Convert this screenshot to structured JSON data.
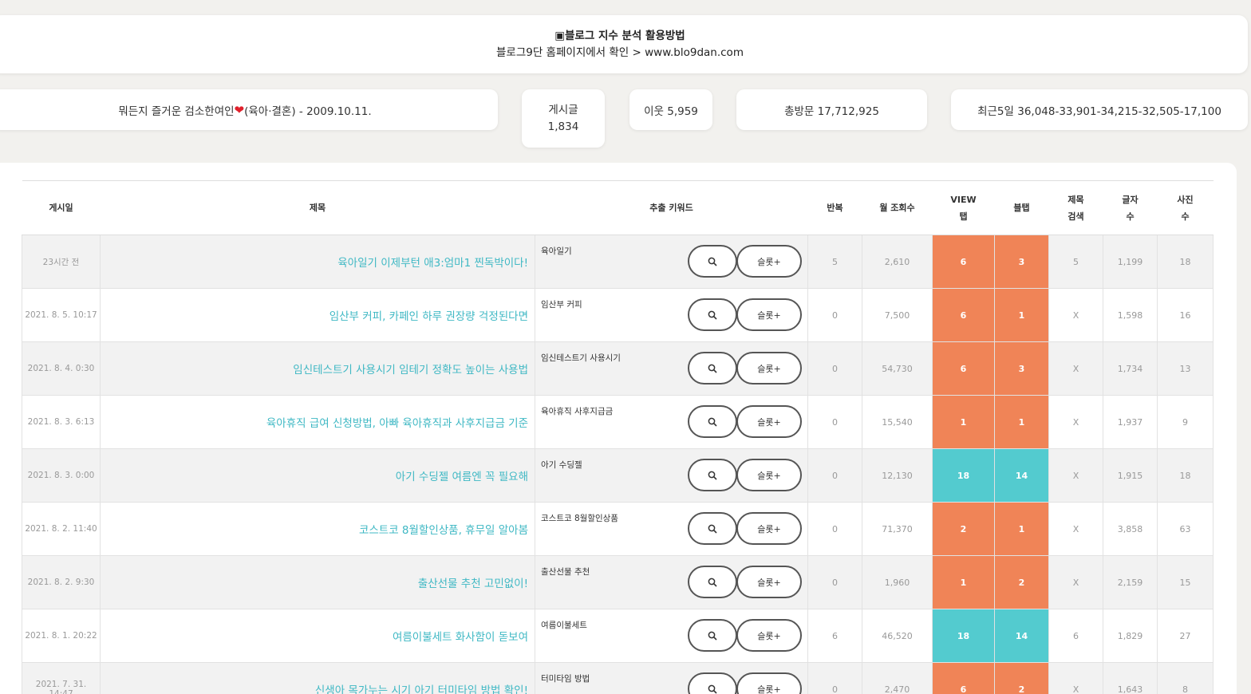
{
  "notice": {
    "line1": "▣블로그 지수 분석 활용방법",
    "line2": "블로그9단 홈페이지에서 확인 > www.blo9dan.com"
  },
  "blog": {
    "name_prefix": "뭐든지 즐거운 검소한여인",
    "heart": "❤",
    "name_suffix": "(육아·결혼) - 2009.10.11.",
    "posts_label": "게시글",
    "posts_value": "1,834",
    "neighbors": "이웃 5,959",
    "total_visits": "총방문 17,712,925",
    "recent5": "최근5일 36,048-33,901-34,215-32,505-17,100"
  },
  "table": {
    "headers": {
      "date": "게시일",
      "title": "제목",
      "keyword": "추출 키워드",
      "repeat": "반복",
      "monthly": "월 조회수",
      "view_tab_1": "VIEW",
      "view_tab_2": "탭",
      "blog_tab": "블탭",
      "title_search_1": "제목",
      "title_search_2": "검색",
      "chars_1": "글자",
      "chars_2": "수",
      "photos_1": "사진",
      "photos_2": "수"
    },
    "search_button_icon": "magnifier-icon",
    "save_button_label": "슬롯+",
    "rows": [
      {
        "date": "23시간 전",
        "title": "육아일기 이제부턴 애3:엄마1 찐독박이다!",
        "keyword": "육아일기",
        "repeat": "5",
        "monthly": "2,610",
        "view": "6",
        "view_color": "orange",
        "blog": "3",
        "blog_color": "orange",
        "title_search": "5",
        "chars": "1,199",
        "photos": "18"
      },
      {
        "date": "2021. 8. 5. 10:17",
        "title": "임산부 커피, 카페인 하루 권장량 걱정된다면",
        "keyword": "임산부 커피",
        "repeat": "0",
        "monthly": "7,500",
        "view": "6",
        "view_color": "orange",
        "blog": "1",
        "blog_color": "orange",
        "title_search": "X",
        "chars": "1,598",
        "photos": "16"
      },
      {
        "date": "2021. 8. 4. 0:30",
        "title": "임신테스트기 사용시기 임테기 정확도 높이는 사용법",
        "keyword": "임신테스트기 사용시기",
        "repeat": "0",
        "monthly": "54,730",
        "view": "6",
        "view_color": "orange",
        "blog": "3",
        "blog_color": "orange",
        "title_search": "X",
        "chars": "1,734",
        "photos": "13"
      },
      {
        "date": "2021. 8. 3. 6:13",
        "title": "육아휴직 급여 신청방법, 아빠 육아휴직과 사후지급금 기준",
        "keyword": "육아휴직 사후지급금",
        "repeat": "0",
        "monthly": "15,540",
        "view": "1",
        "view_color": "orange",
        "blog": "1",
        "blog_color": "orange",
        "title_search": "X",
        "chars": "1,937",
        "photos": "9"
      },
      {
        "date": "2021. 8. 3. 0:00",
        "title": "아기 수딩젤 여름엔 꼭 필요해",
        "keyword": "아기 수딩젤",
        "repeat": "0",
        "monthly": "12,130",
        "view": "18",
        "view_color": "teal",
        "blog": "14",
        "blog_color": "teal",
        "title_search": "X",
        "chars": "1,915",
        "photos": "18"
      },
      {
        "date": "2021. 8. 2. 11:40",
        "title": "코스트코 8월할인상품, 휴무일 알아봄",
        "keyword": "코스트코 8월할인상품",
        "repeat": "0",
        "monthly": "71,370",
        "view": "2",
        "view_color": "orange",
        "blog": "1",
        "blog_color": "orange",
        "title_search": "X",
        "chars": "3,858",
        "photos": "63"
      },
      {
        "date": "2021. 8. 2. 9:30",
        "title": "출산선물 추천 고민없이!",
        "keyword": "출산선물 추천",
        "repeat": "0",
        "monthly": "1,960",
        "view": "1",
        "view_color": "orange",
        "blog": "2",
        "blog_color": "orange",
        "title_search": "X",
        "chars": "2,159",
        "photos": "15"
      },
      {
        "date": "2021. 8. 1. 20:22",
        "title": "여름이불세트 화사함이 돋보여",
        "keyword": "여름이불세트",
        "repeat": "6",
        "monthly": "46,520",
        "view": "18",
        "view_color": "teal",
        "blog": "14",
        "blog_color": "teal",
        "title_search": "6",
        "chars": "1,829",
        "photos": "27"
      },
      {
        "date": "2021. 7. 31. 14:47",
        "title": "신생아 목가누는 시기 아기 터미타임 방법 확인!",
        "keyword": "터미타임 방법",
        "repeat": "0",
        "monthly": "2,470",
        "view": "6",
        "view_color": "orange",
        "blog": "2",
        "blog_color": "orange",
        "title_search": "X",
        "chars": "1,643",
        "photos": "8"
      }
    ]
  }
}
